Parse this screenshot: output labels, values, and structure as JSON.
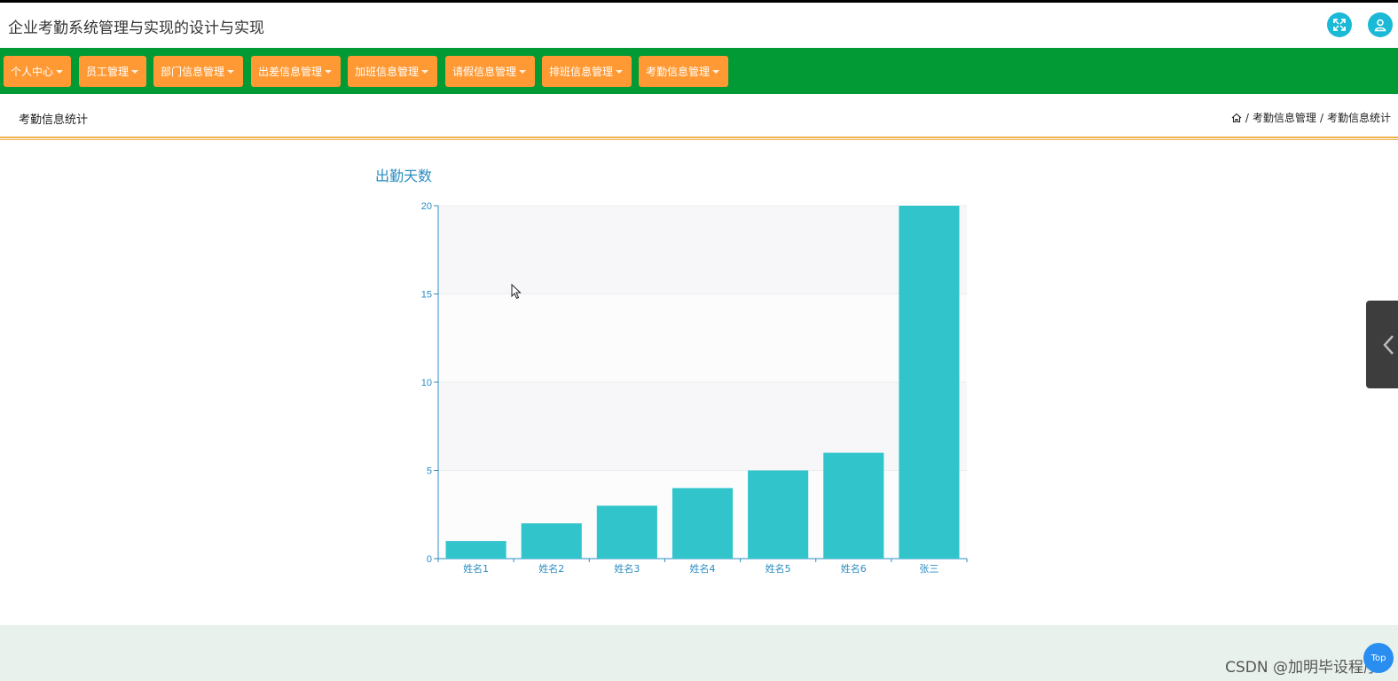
{
  "header": {
    "title": "企业考勤系统管理与实现的设计与实现",
    "fullscreen_icon": "fullscreen-icon",
    "user_icon": "user-icon"
  },
  "nav": {
    "items": [
      {
        "label": "个人中心"
      },
      {
        "label": "员工管理"
      },
      {
        "label": "部门信息管理"
      },
      {
        "label": "出差信息管理"
      },
      {
        "label": "加班信息管理"
      },
      {
        "label": "请假信息管理"
      },
      {
        "label": "排班信息管理"
      },
      {
        "label": "考勤信息管理"
      }
    ]
  },
  "page": {
    "title": "考勤信息统计",
    "breadcrumb": [
      "考勤信息管理",
      "考勤信息统计"
    ]
  },
  "chart_data": {
    "type": "bar",
    "title": "出勤天数",
    "categories": [
      "姓名1",
      "姓名2",
      "姓名3",
      "姓名4",
      "姓名5",
      "姓名6",
      "张三"
    ],
    "values": [
      1,
      2,
      3,
      4,
      5,
      6,
      20
    ],
    "ylim": [
      0,
      20
    ],
    "yticks": [
      0,
      5,
      10,
      15,
      20
    ],
    "xlabel": "",
    "ylabel": "",
    "grid": true,
    "color": "#31c5cb"
  },
  "footer": {
    "watermark": "CSDN @加明毕设程序",
    "top_button": "Top"
  },
  "colors": {
    "navbar": "#019a35",
    "nav_item": "#ff9933",
    "accent": "#1ab9d6",
    "chart_text": "#2c8dc2"
  }
}
